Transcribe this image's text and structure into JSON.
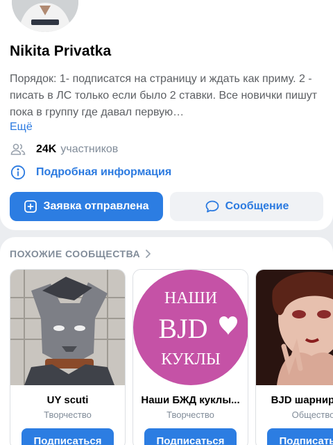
{
  "group": {
    "title": "Nikita Privatka",
    "description": "Порядок:  1- подписатся на страницу и ждать как приму. 2 - писать в ЛС только если было 2 ставки. Все новички пишут пока в группу где давал первую…",
    "more_label": "Ещё",
    "members_count": "24K",
    "members_label": "участников",
    "info_label": "Подробная информация"
  },
  "actions": {
    "request_label": "Заявка отправлена",
    "message_label": "Сообщение"
  },
  "similar": {
    "title": "ПОХОЖИЕ СООБЩЕСТВА",
    "items": [
      {
        "name": "UY scuti",
        "category": "Творчество",
        "button": "Подписаться"
      },
      {
        "name": "Наши БЖД куклы...",
        "category": "Творчество",
        "button": "Подписаться",
        "logo_text_top": "НАШИ",
        "logo_text_mid": "BJD",
        "logo_text_bottom": "КУКЛЫ"
      },
      {
        "name": "BJD шарнирные",
        "category": "Общество",
        "button": "Подписаться"
      }
    ]
  },
  "colors": {
    "accent": "#2c7de2",
    "link": "#2b7ae0",
    "secondary_text": "#818c99",
    "logo_bg": "#c552a6"
  }
}
